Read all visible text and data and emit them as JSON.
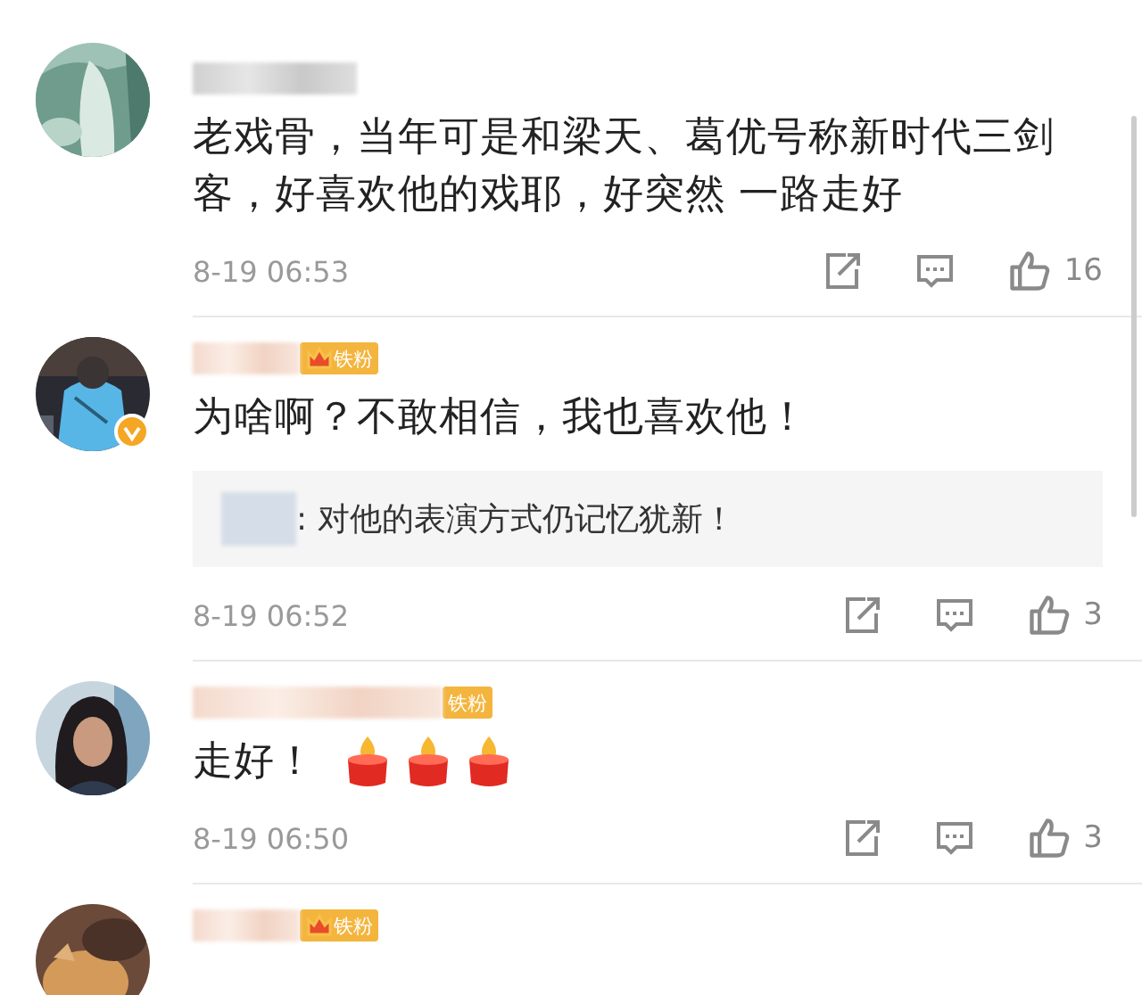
{
  "comments": [
    {
      "verified": false,
      "text": "老戏骨，当年可是和梁天、葛优号称新时代三剑客，好喜欢他的戏耶，好突然 一路走好",
      "time": "8-19 06:53",
      "likes": "16"
    },
    {
      "verified": true,
      "badge": {
        "label": "铁粉",
        "crown": true
      },
      "text": "为啥啊？不敢相信，我也喜欢他！",
      "reply": {
        "text": ": 对他的表演方式仍记忆犹新！"
      },
      "time": "8-19 06:52",
      "likes": "3"
    },
    {
      "verified": false,
      "badge": {
        "label": "铁粉",
        "crown": false
      },
      "text": "走好！",
      "emojis": [
        {
          "kind": "candle"
        },
        {
          "kind": "candle"
        },
        {
          "kind": "candle"
        }
      ],
      "time": "8-19 06:50",
      "likes": "3"
    },
    {
      "verified": false,
      "badge": {
        "label": "铁粉",
        "crown": true
      }
    }
  ]
}
